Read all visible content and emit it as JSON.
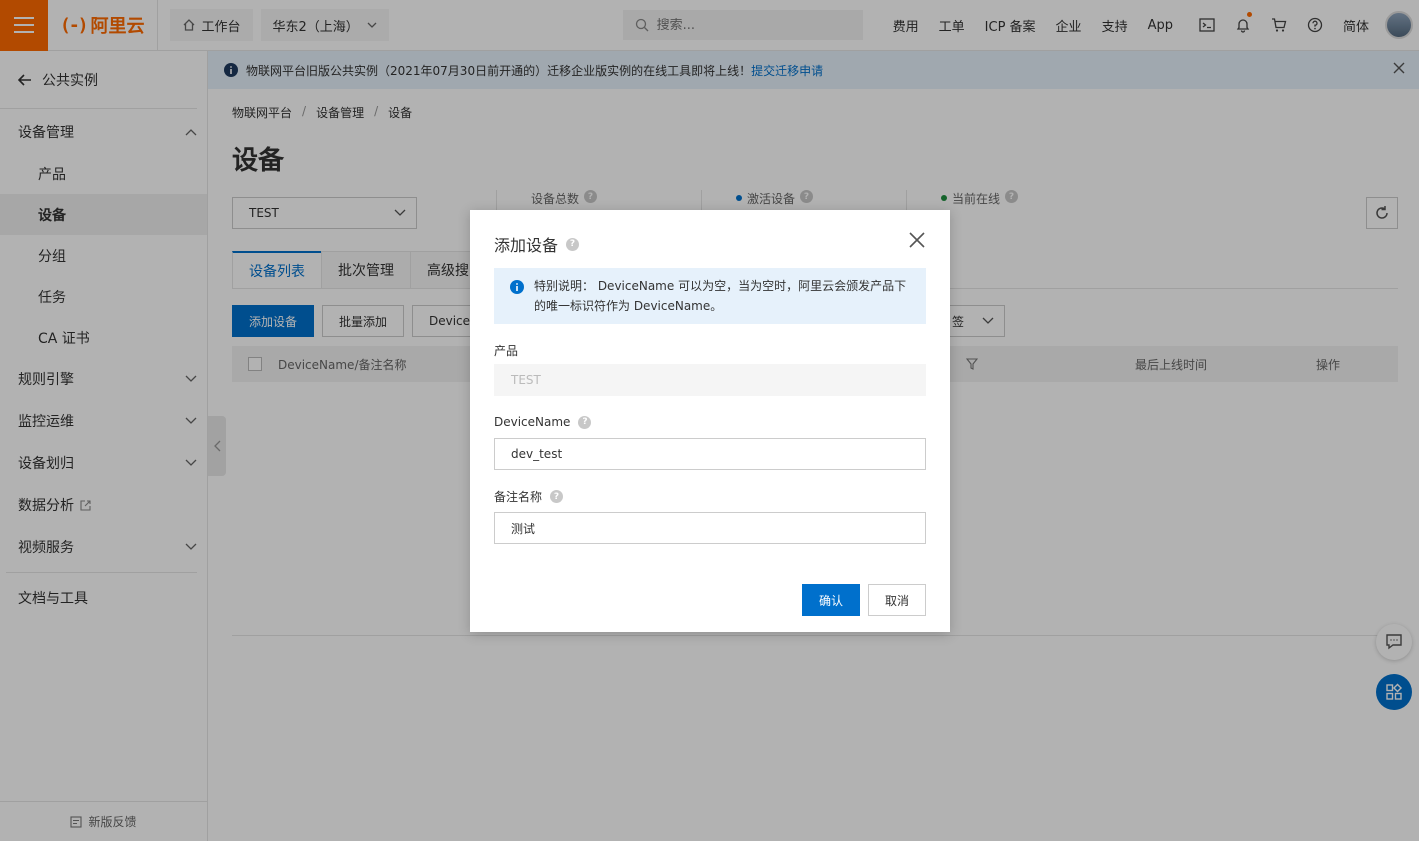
{
  "topbar": {
    "logo_mark": "(-)",
    "logo_text": "阿里云",
    "workbench": "工作台",
    "region": "华东2（上海）",
    "search_placeholder": "搜索...",
    "links": [
      "费用",
      "工单",
      "ICP 备案",
      "企业",
      "支持",
      "App"
    ],
    "lang": "简体",
    "brand_color": "#ff6a00"
  },
  "sidebar": {
    "back_label": "公共实例",
    "groups": {
      "device_mgmt": "设备管理",
      "rules": "规则引擎",
      "monitor": "监控运维",
      "device_assign": "设备划归",
      "data_analysis": "数据分析",
      "video": "视频服务",
      "docs": "文档与工具"
    },
    "items": [
      "产品",
      "设备",
      "分组",
      "任务",
      "CA 证书"
    ],
    "active_item": "设备",
    "feedback": "新版反馈"
  },
  "notice": {
    "text": "物联网平台旧版公共实例（2021年07月30日前开通的）迁移企业版实例的在线工具即将上线！",
    "link": "提交迁移申请"
  },
  "breadcrumb": [
    "物联网平台",
    "设备管理",
    "设备"
  ],
  "page_title": "设备",
  "product_select": "TEST",
  "stats": [
    "设备总数",
    "激活设备",
    "当前在线"
  ],
  "tabs": [
    "设备列表",
    "批次管理",
    "高级搜"
  ],
  "toolbar": {
    "add": "添加设备",
    "batch": "批量添加",
    "filter": "DeviceN",
    "tag_filter": "签"
  },
  "table": {
    "headers": [
      "DeviceName/备注名称",
      "最后上线时间",
      "操作"
    ]
  },
  "dialog": {
    "title": "添加设备",
    "info": "特别说明： DeviceName 可以为空，当为空时，阿里云会颁发产品下的唯一标识符作为 DeviceName。",
    "product_label": "产品",
    "product_value": "TEST",
    "devicename_label": "DeviceName",
    "devicename_value": "dev_test",
    "remark_label": "备注名称",
    "remark_value": "测试",
    "ok": "确认",
    "cancel": "取消"
  }
}
